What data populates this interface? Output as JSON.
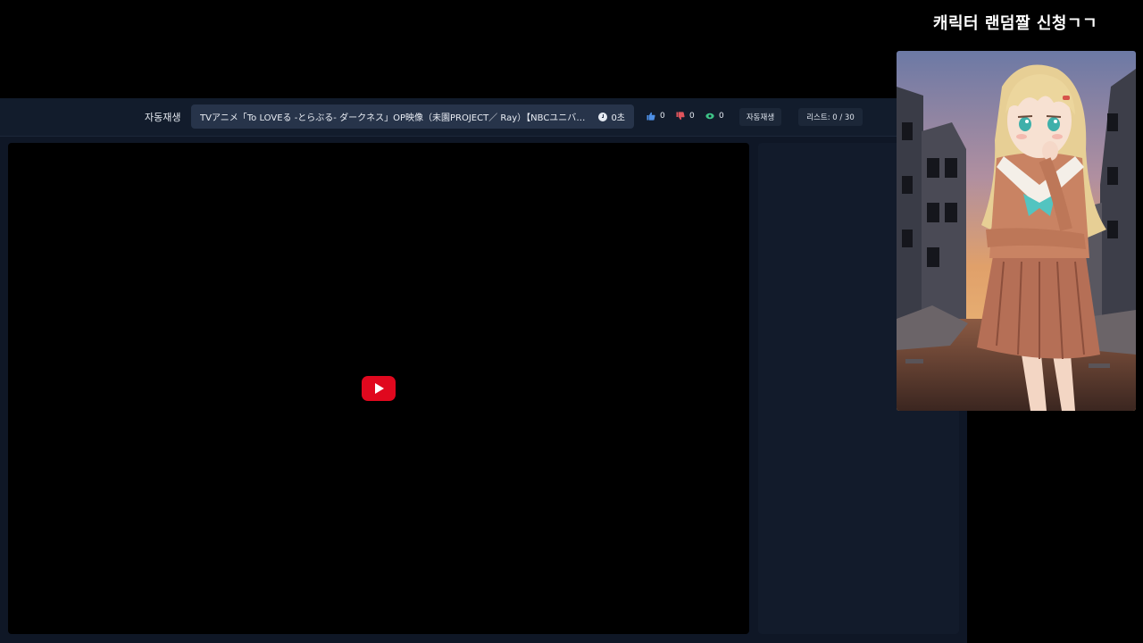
{
  "toolbar": {
    "autoplay_label": "자동재생",
    "now_playing_title": "TVアニメ「To LOVEる -とらぶる- ダークネス」OP映像（未園PROJECT／ Ray）【NBCユニバーサルAnim…",
    "duration": "0초",
    "likes": "0",
    "dislikes": "0",
    "views": "0",
    "autoplay_button": "자동재생",
    "list_counter": "리스트: 0 / 30"
  },
  "overlay": {
    "title": "캐릭터 랜덤짤 신청ㄱㄱ"
  },
  "colors": {
    "like": "#4d8fe6",
    "dislike": "#e0545c",
    "views": "#3ec488",
    "youtube_red": "#e0081e"
  }
}
